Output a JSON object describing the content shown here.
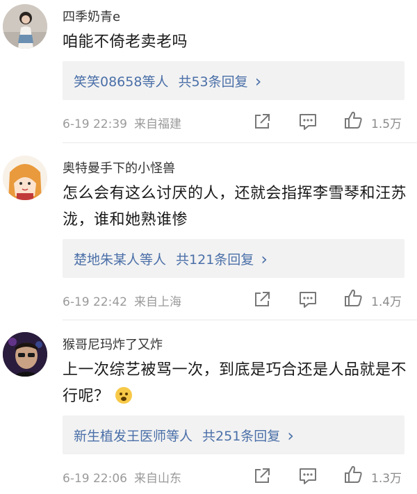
{
  "comments": [
    {
      "username": "四季奶青e",
      "content": "咱能不倚老卖老吗",
      "reply_users": "笑笑08658等人",
      "reply_count": "共53条回复",
      "reply_chevron": "›",
      "time": "6-19 22:39",
      "location": "来自福建",
      "likes": "1.5万"
    },
    {
      "username": "奥特曼手下的小怪兽",
      "content": "怎么会有这么讨厌的人，还就会指挥李雪琴和汪苏泷，谁和她熟谁惨",
      "reply_users": "楚地朱某人等人",
      "reply_count": "共121条回复",
      "reply_chevron": "›",
      "time": "6-19 22:42",
      "location": "来自上海",
      "likes": "1.4万"
    },
    {
      "username": "猴哥尼玛炸了又炸",
      "content": "上一次综艺被骂一次，到底是巧合还是人品就是不行呢？",
      "reply_users": "新生植发王医师等人",
      "reply_count": "共251条回复",
      "reply_chevron": "›",
      "time": "6-19 22:06",
      "location": "来自山东",
      "likes": "1.3万"
    }
  ],
  "icons": {
    "share": "share-icon",
    "comment": "comment-icon",
    "like": "thumbs-up-icon",
    "reaction": "fearful-face-emoji"
  },
  "colors": {
    "reply_link": "#4a6fa8",
    "meta_text": "#9a9a9a",
    "reply_bg": "#f2f2f2"
  }
}
